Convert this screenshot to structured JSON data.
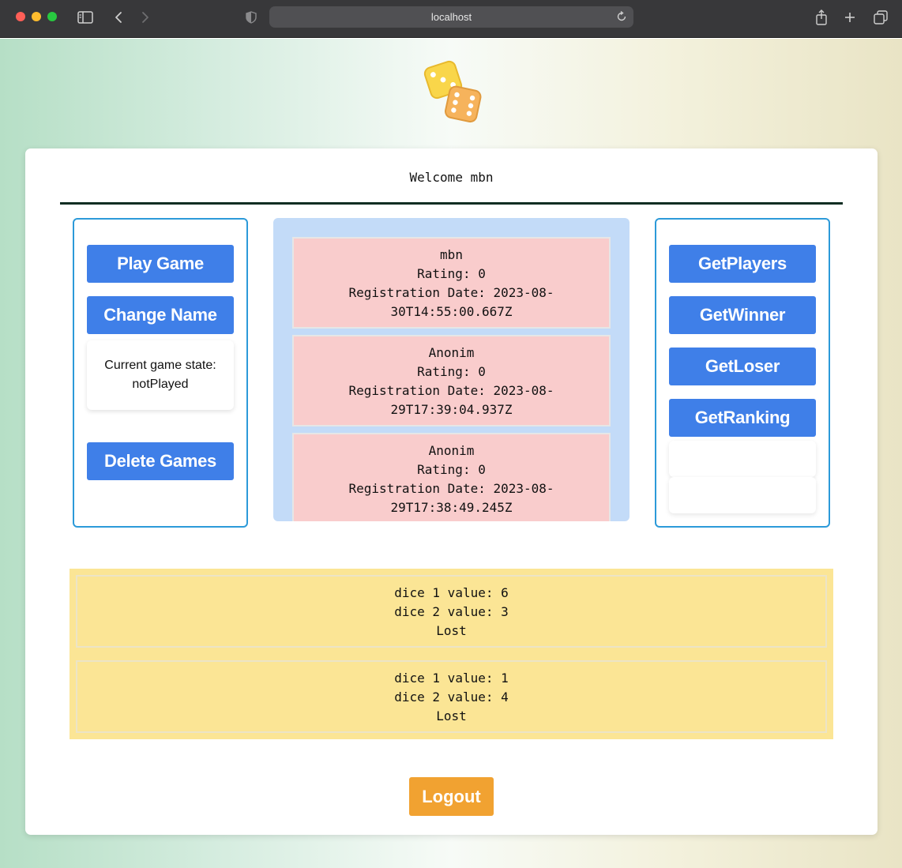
{
  "browser": {
    "address": "localhost"
  },
  "header": {
    "welcome": "Welcome mbn"
  },
  "left_panel": {
    "play_game": "Play Game",
    "change_name": "Change Name",
    "game_state": "Current game state: notPlayed",
    "delete_games": "Delete Games"
  },
  "players": [
    {
      "name": "mbn",
      "rating": "Rating: 0",
      "date_line1": "Registration Date: 2023-08-",
      "date_line2": "30T14:55:00.667Z"
    },
    {
      "name": "Anonim",
      "rating": "Rating: 0",
      "date_line1": "Registration Date: 2023-08-",
      "date_line2": "29T17:39:04.937Z"
    },
    {
      "name": "Anonim",
      "rating": "Rating: 0",
      "date_line1": "Registration Date: 2023-08-",
      "date_line2": "29T17:38:49.245Z"
    }
  ],
  "right_panel": {
    "get_players": "GetPlayers",
    "get_winner": "GetWinner",
    "get_loser": "GetLoser",
    "get_ranking": "GetRanking"
  },
  "games": [
    {
      "dice1": "dice 1 value: 6",
      "dice2": "dice 2 value: 3",
      "result": "Lost"
    },
    {
      "dice1": "dice 1 value: 1",
      "dice2": "dice 2 value: 4",
      "result": "Lost"
    }
  ],
  "footer": {
    "logout": "Logout"
  },
  "icons": {
    "logo": "dice-icon",
    "sidebar": "sidebar-toggle-icon",
    "back": "chevron-left-icon",
    "forward": "chevron-right-icon",
    "shield": "shield-icon",
    "reload": "reload-icon",
    "share": "share-icon",
    "new_tab": "plus-icon",
    "tabs": "tabs-overview-icon"
  },
  "colors": {
    "primary_button": "#3f7fe8",
    "logout_button": "#f1a231",
    "panel_border": "#2c9ad9",
    "players_bg": "#c3dbf8",
    "player_card_bg": "#f9cccc",
    "results_bg": "#fbe595"
  }
}
